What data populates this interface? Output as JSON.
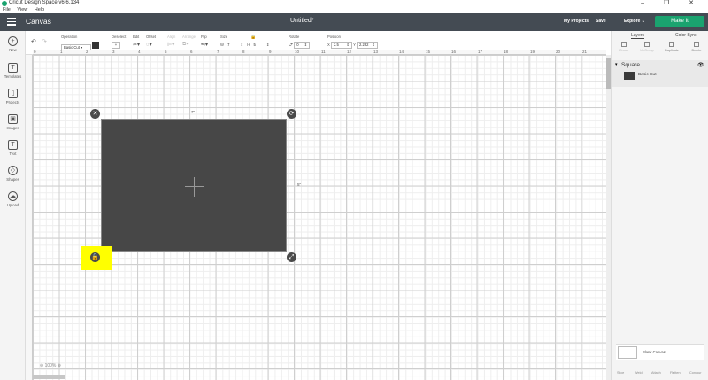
{
  "titlebar": {
    "app_title": "Cricut Design Space  v6.6.134",
    "window_controls": "–  ❐  ✕"
  },
  "menubar": {
    "items": [
      "File",
      "View",
      "Help"
    ]
  },
  "header": {
    "title": "Canvas",
    "document": "Untitled*",
    "my_projects": "My Projects",
    "save": "Save",
    "separator": "|",
    "explore": "Explore",
    "make_it": "Make It"
  },
  "left_rail": [
    {
      "icon": "+",
      "label": "New"
    },
    {
      "icon": "T",
      "label": "Templates"
    },
    {
      "icon": "▯",
      "label": "Projects"
    },
    {
      "icon": "▣",
      "label": "Images"
    },
    {
      "icon": "T",
      "label": "Text"
    },
    {
      "icon": "◇",
      "label": "Shapes"
    },
    {
      "icon": "☁",
      "label": "Upload"
    }
  ],
  "toolbar": {
    "undo": "↶",
    "redo": "↷",
    "operation_label": "Operation",
    "operation_value": "Basic Cut",
    "deselect_label": "Deselect",
    "edit_label": "Edit",
    "offset_label": "Offset",
    "align_label": "Align",
    "arrange_label": "Arrange",
    "flip_label": "Flip",
    "size_label": "Size",
    "w_label": "W",
    "w_value": "7",
    "h_label": "H",
    "h_value": "5",
    "rotate_label": "Rotate",
    "rotate_value": "0",
    "position_label": "Position",
    "x_label": "X",
    "x_value": "2.5",
    "y_label": "Y",
    "y_value": "2.292"
  },
  "ruler_top": [
    "0",
    "1",
    "2",
    "3",
    "4",
    "5",
    "6",
    "7",
    "8",
    "9",
    "10",
    "11",
    "12",
    "13",
    "14",
    "15",
    "16",
    "17",
    "18",
    "19",
    "20",
    "21"
  ],
  "canvas": {
    "width_label": "7\"",
    "height_label": "5\"",
    "zoom": "100%"
  },
  "right_panel": {
    "tabs": [
      "Layers",
      "Color Sync"
    ],
    "actions": [
      "Group",
      "UnGroup",
      "Duplicate",
      "Delete"
    ],
    "layer_name": "Square",
    "layer_operation": "Basic Cut",
    "blank_canvas": "Blank Canvas",
    "bottom_actions": [
      "Slice",
      "Weld",
      "Attach",
      "Flatten",
      "Contour"
    ]
  },
  "colors": {
    "header_bg": "#444b53",
    "make_it": "#1aa36f",
    "highlight": "#ffff00",
    "shape_fill": "#474747"
  }
}
